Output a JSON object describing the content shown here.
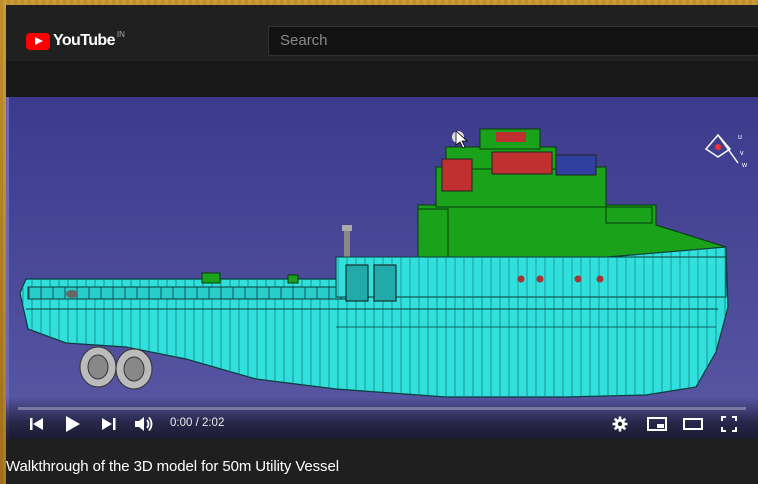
{
  "header": {
    "logo_text": "YouTube",
    "country_code": "IN",
    "search_placeholder": "Search"
  },
  "player": {
    "time_display": "0:00 / 2:02",
    "progress_fraction": 0.0
  },
  "video": {
    "title": "Walkthrough of the 3D model for 50m Utility Vessel"
  },
  "colors": {
    "hull": "#30e0dc",
    "superstructure": "#1aa21a",
    "background": "#4d4a9c",
    "brand_red": "#ff0000"
  }
}
